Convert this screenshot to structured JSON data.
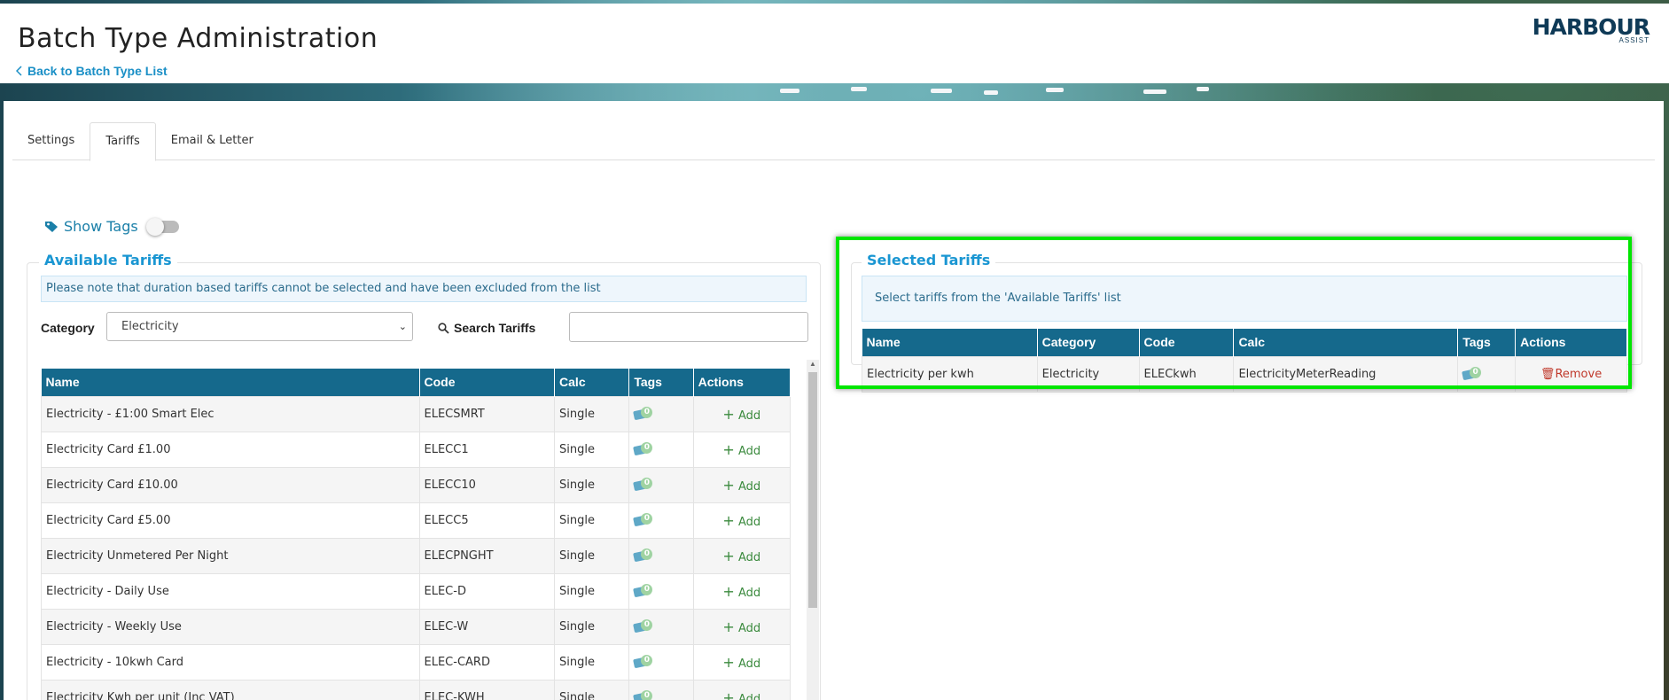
{
  "header": {
    "title": "Batch Type Administration",
    "back_label": "Back to Batch Type List",
    "logo_main": "HARBOUR",
    "logo_sub": "ASSIST"
  },
  "tabs": [
    {
      "label": "Settings"
    },
    {
      "label": "Tariffs"
    },
    {
      "label": "Email & Letter"
    }
  ],
  "show_tags": {
    "label": "Show Tags",
    "enabled": false
  },
  "available": {
    "legend": "Available Tariffs",
    "note": "Please note that duration based tariffs cannot be selected and have been excluded from the list",
    "category_label": "Category",
    "category_value": "Electricity",
    "search_label": "Search Tariffs",
    "search_value": "",
    "columns": [
      "Name",
      "Code",
      "Calc",
      "Tags",
      "Actions"
    ],
    "rows": [
      {
        "name": "Electricity - £1:00 Smart Elec",
        "code": "ELECSMRT",
        "calc": "Single",
        "tags": "0",
        "action": "Add"
      },
      {
        "name": "Electricity Card £1.00",
        "code": "ELECC1",
        "calc": "Single",
        "tags": "0",
        "action": "Add"
      },
      {
        "name": "Electricity Card £10.00",
        "code": "ELECC10",
        "calc": "Single",
        "tags": "0",
        "action": "Add"
      },
      {
        "name": "Electricity Card £5.00",
        "code": "ELECC5",
        "calc": "Single",
        "tags": "0",
        "action": "Add"
      },
      {
        "name": "Electricity Unmetered Per Night",
        "code": "ELECPNGHT",
        "calc": "Single",
        "tags": "0",
        "action": "Add"
      },
      {
        "name": "Electricity - Daily Use",
        "code": "ELEC-D",
        "calc": "Single",
        "tags": "0",
        "action": "Add"
      },
      {
        "name": "Electricity - Weekly Use",
        "code": "ELEC-W",
        "calc": "Single",
        "tags": "0",
        "action": "Add"
      },
      {
        "name": "Electricity - 10kwh Card",
        "code": "ELEC-CARD",
        "calc": "Single",
        "tags": "0",
        "action": "Add"
      },
      {
        "name": "Electricity Kwh per unit (Inc VAT)",
        "code": "ELEC-KWH",
        "calc": "Single",
        "tags": "0",
        "action": "Add"
      }
    ]
  },
  "selected": {
    "legend": "Selected Tariffs",
    "note": "Select tariffs from the 'Available Tariffs' list",
    "columns": [
      "Name",
      "Category",
      "Code",
      "Calc",
      "Tags",
      "Actions"
    ],
    "rows": [
      {
        "name": "Electricity per kwh",
        "category": "Electricity",
        "code": "ELECkwh",
        "calc": "ElectricityMeterReading",
        "tags": "0",
        "action": "Remove"
      }
    ]
  },
  "colors": {
    "header_blue": "#15698c",
    "link_blue": "#1a8fc6",
    "add_green": "#3b8a3e",
    "remove_red": "#c0392b",
    "highlight": "#00e600"
  }
}
